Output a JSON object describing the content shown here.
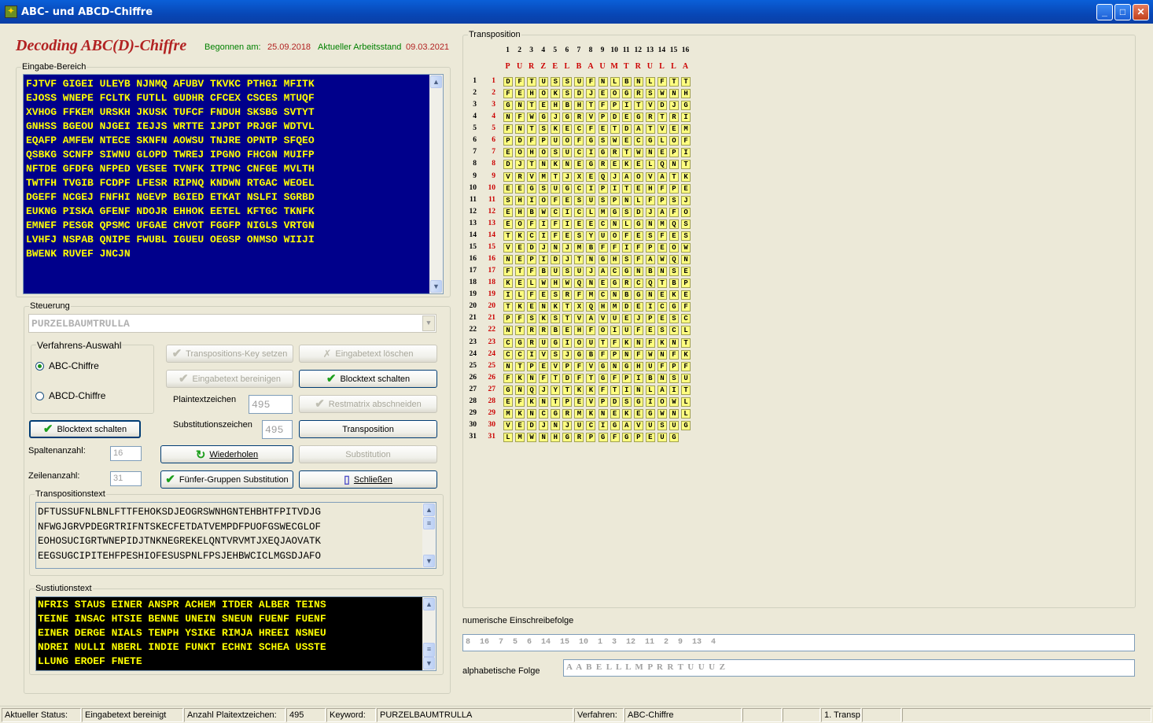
{
  "window": {
    "title": "ABC- und ABCD-Chiffre"
  },
  "header": {
    "title": "Decoding ABC(D)-Chiffre",
    "begonnen_label": "Begonnen am:",
    "begonnen_date": "25.09.2018",
    "stand_label": "Aktueller Arbeitsstand",
    "stand_date": "09.03.2021"
  },
  "eingabe": {
    "label": "Eingabe-Bereich",
    "rows": [
      "FJTVF GIGEI ULEYB NJNMQ AFUBV TKVKC PTHGI MFITK",
      "EJOSS WNEPE FCLTK FUTLL GUDHR CFCEX CSCES MTUQF",
      "XVHOG FFKEM URSKH JKUSK TUFCF FNDUH SKSBG SVTYT",
      "GNHSS BGEOU NJGEI IEJJS WRTTE IJPDT PRJGF WDTVL",
      "EQAFP AMFEW NTECE SKNFN AOWSU TNJRE OPNTP SFQEO",
      "QSBKG SCNFP SIWNU GLOPD TWREJ IPGNO FHCGN MUIFP",
      "NFTDE GFDFG NFPED VESEE TVNFK ITPNC CNFGE MVLTH",
      "TWTFH TVGIB FCDPF LFESR RIPNQ KNDWN RTGAC WEOEL",
      "DGEFF NCGEJ FNFHI NGEVP BGIED ETKAT NSLFI SGRBD",
      "EUKNG PISKA GFENF NDOJR EHHOK EETEL KFTGC TKNFK",
      "EMNEF PESGR QPSMC UFGAE CHVOT FGGFP NIGLS VRTGN",
      "LVHFJ NSPAB QNIPE FWUBL IGUEU OEGSP ONMSO WIIJI",
      "BWENK RUVEF JNCJN"
    ]
  },
  "steuerung": {
    "label": "Steuerung",
    "keyword": "PURZELBAUMTRULLA"
  },
  "verfahren": {
    "label": "Verfahrens-Auswahl",
    "opt1": "ABC-Chiffre",
    "opt2": "ABCD-Chiffre"
  },
  "buttons": {
    "transpositions_key": "Transpositions-Key setzen",
    "eingabetext_loeschen": "Eingabetext löschen",
    "eingabetext_bereinigen": "Eingabetext bereinigen",
    "blocktext_schalten": "Blocktext schalten",
    "restmatrix": "Restmatrix abschneiden",
    "transposition": "Transposition",
    "substitution": "Substitution",
    "wiederholen": "Wiederholen",
    "fuenfer": "Fünfer-Gruppen Substitution",
    "schliessen": "Schließen",
    "blocktext_left": "Blocktext schalten"
  },
  "fields": {
    "plain_label": "Plaintextzeichen",
    "plain_value": "495",
    "subst_label": "Substitutionszeichen",
    "subst_value": "495",
    "spalten_label": "Spaltenanzahl:",
    "spalten_value": "16",
    "zeilen_label": "Zeilenanzahl:",
    "zeilen_value": "31"
  },
  "transpositionstext": {
    "label": "Transpositionstext",
    "rows": [
      "DFTUSSUFNLBNLFTTFEHOKSDJEOGRSWNHGNTEHBHTFPITVDJG",
      "NFWGJGRVPDEGRTRIFNTSKECFETDATVEMPDFPUOFGSWECGLOF",
      "EOHOSUCIGRTWNEPIDJTNKNEGREKELQNTVRVMTJXEQJAOVATK",
      "EEGSUGCIPITEHFPESHIOFESUSPNLFPSJEHBWCICLMGSDJAFO"
    ]
  },
  "substitutionstext": {
    "label": "Sustiutionstext",
    "rows": [
      "NFRIS STAUS EINER ANSPR ACHEM ITDER ALBER TEINS",
      "TEINE INSAC HTSIE BENNE UNEIN SNEUN FUENF FUENF",
      "EINER DERGE NIALS TENPH YSIKE RIMJA HREEI NSNEU",
      "NDREI NULLI NBERL INDIE FUNKT ECHNI SCHEA USSTE",
      "LLUNG EROEF FNETE"
    ]
  },
  "transposition": {
    "label": "Transposition",
    "col_numbers": [
      "1",
      "2",
      "3",
      "4",
      "5",
      "6",
      "7",
      "8",
      "9",
      "10",
      "11",
      "12",
      "13",
      "14",
      "15",
      "16"
    ],
    "key_letters": [
      "P",
      "U",
      "R",
      "Z",
      "E",
      "L",
      "B",
      "A",
      "U",
      "M",
      "T",
      "R",
      "U",
      "L",
      "L",
      "A"
    ],
    "rows": [
      "DFTUSSUFNLBNLFTT",
      "FEHOKSDJEOGRSWNH",
      "GNTEHBHTFPITVDJG",
      "NFWGJGRVPDEGRTRI",
      "FNTSKECFETDATVEM",
      "PDFPUOFGSWECGLOF",
      "EOHOSUCIGRTWNEPI",
      "DJTNKNEGREKELQNT",
      "VRVMTJXEQJAOVATK",
      "EEGSUGCIPITEHFPE",
      "SHIOFESUSPNLFPSJ",
      "EHBWCICLMGSDJAFO",
      "EOFIFIEECNLGNMQS",
      "TKCIFESYUOFESFES",
      "VEDJNJMBFFIFPEOW",
      "NEPIDJTNGHSFAWQN",
      "FTFBUSUJACGNBNSE",
      "KELWHWQNEGRCQTBP",
      "ILFESRFMCNBGNEKE",
      "TKENKTXQHMDEICGF",
      "PFSKSTVAVUEJPESC",
      "NTRRBEHFOIUFESCL",
      "CGRUGIOUTFKNFKNT",
      "CCIVSJGBFPNFWNFK",
      "NTPEVPFVGNGHUFPF",
      "FKNFTDFTGFPIBNSU",
      "GNQJYTKKFTINLAIT",
      "EFKNTPEVPDSGIOWL",
      "MKNCGRMKNEKEGWNL",
      "VEDJNJUCIGAVUSUG",
      "LMWNHGRPGFGPEUG"
    ]
  },
  "numerisch": {
    "label": "numerische Einschreibefolge",
    "value": "8  16  7  5  6  14  15  10  1  3  12  11  2  9  13  4"
  },
  "alphabetisch": {
    "label": "alphabetische Folge",
    "value": "A  A  B  E  L  L  L  M  P  R  R  T  U  U  U  Z"
  },
  "status": {
    "aktueller": "Aktueller Status:",
    "status_value": "Eingabetext bereinigt",
    "anzahl_label": "Anzahl Plaitextzeichen:",
    "anzahl_value": "495",
    "keyword_label": "Keyword:",
    "keyword_value": "PURZELBAUMTRULLA",
    "verfahren_label": "Verfahren:",
    "verfahren_value": "ABC-Chiffre",
    "step": "1. Transp"
  }
}
